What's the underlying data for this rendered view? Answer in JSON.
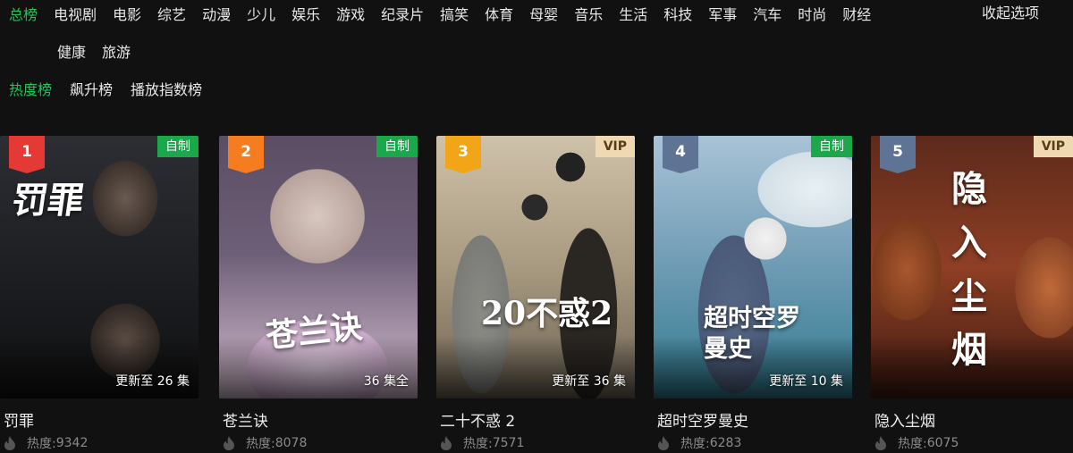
{
  "categories": {
    "row1": [
      "总榜",
      "电视剧",
      "电影",
      "综艺",
      "动漫",
      "少儿",
      "娱乐",
      "游戏",
      "纪录片",
      "搞笑",
      "体育",
      "母婴",
      "音乐",
      "生活",
      "科技",
      "军事",
      "汽车",
      "时尚",
      "财经"
    ],
    "row2": [
      "健康",
      "旅游"
    ],
    "active": "总榜",
    "collapse_label": "收起选项"
  },
  "subtabs": {
    "items": [
      "热度榜",
      "飙升榜",
      "播放指数榜"
    ],
    "active": "热度榜"
  },
  "heat_prefix": "热度: ",
  "cards": [
    {
      "rank": "1",
      "badge": "自制",
      "badge_type": "green",
      "episodes": "更新至 26 集",
      "poster_title": "罚罪",
      "title": "罚罪",
      "heat": "9342",
      "rank_color": "#e53935"
    },
    {
      "rank": "2",
      "badge": "自制",
      "badge_type": "green",
      "episodes": "36 集全",
      "poster_title": "苍兰诀",
      "title": "苍兰诀",
      "heat": "8078",
      "rank_color": "#f57c1f"
    },
    {
      "rank": "3",
      "badge": "VIP",
      "badge_type": "vip",
      "episodes": "更新至 36 集",
      "poster_title": "20不惑2",
      "title": "二十不惑 2",
      "heat": "7571",
      "rank_color": "#f2a516"
    },
    {
      "rank": "4",
      "badge": "自制",
      "badge_type": "green",
      "episodes": "更新至 10 集",
      "poster_title": "超时空罗曼史",
      "title": "超时空罗曼史",
      "heat": "6283",
      "rank_color": "#5f7494"
    },
    {
      "rank": "5",
      "badge": "VIP",
      "badge_type": "vip",
      "episodes": "",
      "poster_title": "隐入尘烟",
      "title": "隐入尘烟",
      "heat": "6075",
      "rank_color": "#5f7494"
    }
  ],
  "colors": {
    "accent": "#1fc55b",
    "background": "#111111"
  }
}
